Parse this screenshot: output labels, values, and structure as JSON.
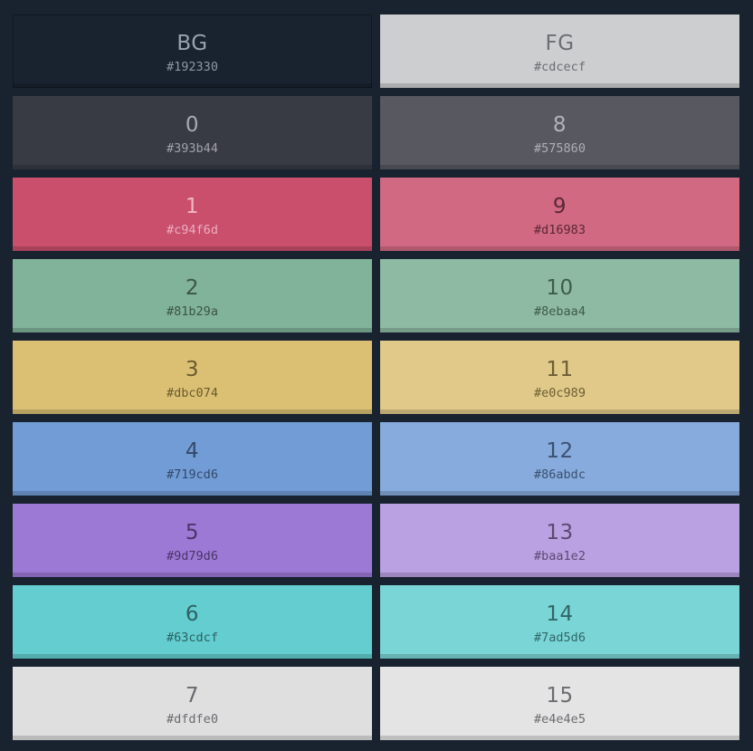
{
  "swatches": [
    {
      "name": "BG",
      "hex": "#192330",
      "color": "#192330",
      "text_color": "#9aa3ad",
      "hex_color": "#8e97a2"
    },
    {
      "name": "FG",
      "hex": "#cdcecf",
      "color": "#cdcecf",
      "text_color": "#6b6e72",
      "hex_color": "#6b6e72"
    },
    {
      "name": "0",
      "hex": "#393b44",
      "color": "#393b44",
      "text_color": "#a9abb1",
      "hex_color": "#a0a2a8"
    },
    {
      "name": "8",
      "hex": "#575860",
      "color": "#575860",
      "text_color": "#b2b3b8",
      "hex_color": "#aeafb4"
    },
    {
      "name": "1",
      "hex": "#c94f6d",
      "color": "#c94f6d",
      "text_color": "#efb6c3",
      "hex_color": "#ecaebe"
    },
    {
      "name": "9",
      "hex": "#d16983",
      "color": "#d16983",
      "text_color": "#5a2834",
      "hex_color": "#5a2834"
    },
    {
      "name": "2",
      "hex": "#81b29a",
      "color": "#81b29a",
      "text_color": "#3c5548",
      "hex_color": "#3c5548"
    },
    {
      "name": "10",
      "hex": "#8ebaa4",
      "color": "#8ebaa4",
      "text_color": "#3f5a4c",
      "hex_color": "#3f5a4c"
    },
    {
      "name": "3",
      "hex": "#dbc074",
      "color": "#dbc074",
      "text_color": "#6a5a2c",
      "hex_color": "#6a5a2c"
    },
    {
      "name": "11",
      "hex": "#e0c989",
      "color": "#e0c989",
      "text_color": "#6d5e34",
      "hex_color": "#6d5e34"
    },
    {
      "name": "4",
      "hex": "#719cd6",
      "color": "#719cd6",
      "text_color": "#34496a",
      "hex_color": "#34496a"
    },
    {
      "name": "12",
      "hex": "#86abdc",
      "color": "#86abdc",
      "text_color": "#3c5070",
      "hex_color": "#3c5070"
    },
    {
      "name": "5",
      "hex": "#9d79d6",
      "color": "#9d79d6",
      "text_color": "#4a3569",
      "hex_color": "#4a3569"
    },
    {
      "name": "13",
      "hex": "#baa1e2",
      "color": "#baa1e2",
      "text_color": "#5a4a72",
      "hex_color": "#5a4a72"
    },
    {
      "name": "6",
      "hex": "#63cdcf",
      "color": "#63cdcf",
      "text_color": "#2b6264",
      "hex_color": "#2b6264"
    },
    {
      "name": "14",
      "hex": "#7ad5d6",
      "color": "#7ad5d6",
      "text_color": "#326668",
      "hex_color": "#326668"
    },
    {
      "name": "7",
      "hex": "#dfdfe0",
      "color": "#dfdfe0",
      "text_color": "#6a6a6e",
      "hex_color": "#6a6a6e"
    },
    {
      "name": "15",
      "hex": "#e4e4e5",
      "color": "#e4e4e5",
      "text_color": "#6c6c70",
      "hex_color": "#6c6c70"
    }
  ]
}
